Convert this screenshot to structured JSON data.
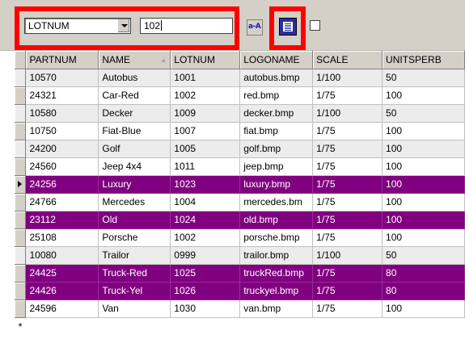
{
  "toolbar": {
    "field_select": "LOTNUM",
    "search_text": "102",
    "sort_button_label": "a-A",
    "checkbox_checked": false
  },
  "grid": {
    "columns": [
      "PARTNUM",
      "NAME",
      "LOTNUM",
      "LOGONAME",
      "SCALE",
      "UNITSPERB"
    ],
    "sorted_column": "NAME",
    "current_row": 6,
    "rows": [
      {
        "cells": [
          "10570",
          "Autobus",
          "1001",
          "autobus.bmp",
          "1/100",
          "50"
        ],
        "highlighted": false
      },
      {
        "cells": [
          "24321",
          "Car-Red",
          "1002",
          "red.bmp",
          "1/75",
          "100"
        ],
        "highlighted": false
      },
      {
        "cells": [
          "10580",
          "Decker",
          "1009",
          "decker.bmp",
          "1/100",
          "50"
        ],
        "highlighted": false
      },
      {
        "cells": [
          "10750",
          "Fiat-Blue",
          "1007",
          "fiat.bmp",
          "1/75",
          "100"
        ],
        "highlighted": false
      },
      {
        "cells": [
          "24200",
          "Golf",
          "1005",
          "golf.bmp",
          "1/75",
          "100"
        ],
        "highlighted": false
      },
      {
        "cells": [
          "24560",
          "Jeep 4x4",
          "1011",
          "jeep.bmp",
          "1/75",
          "100"
        ],
        "highlighted": false
      },
      {
        "cells": [
          "24256",
          "Luxury",
          "1023",
          "luxury.bmp",
          "1/75",
          "100"
        ],
        "highlighted": true
      },
      {
        "cells": [
          "24766",
          "Mercedes",
          "1004",
          "mercedes.bm",
          "1/75",
          "100"
        ],
        "highlighted": false
      },
      {
        "cells": [
          "23112",
          "Old",
          "1024",
          "old.bmp",
          "1/75",
          "100"
        ],
        "highlighted": true
      },
      {
        "cells": [
          "25108",
          "Porsche",
          "1002",
          "porsche.bmp",
          "1/75",
          "100"
        ],
        "highlighted": false
      },
      {
        "cells": [
          "10080",
          "Trailor",
          "0999",
          "trailor.bmp",
          "1/100",
          "50"
        ],
        "highlighted": false
      },
      {
        "cells": [
          "24425",
          "Truck-Red",
          "1025",
          "truckRed.bmp",
          "1/75",
          "80"
        ],
        "highlighted": true
      },
      {
        "cells": [
          "24426",
          "Truck-Yel",
          "1026",
          "truckyel.bmp",
          "1/75",
          "80"
        ],
        "highlighted": true
      },
      {
        "cells": [
          "24596",
          "Van",
          "1030",
          "van.bmp",
          "1/75",
          "100"
        ],
        "highlighted": false
      }
    ],
    "new_row_marker": "*"
  },
  "colors": {
    "highlight_row": "#800080",
    "annotation_box": "#ff0000",
    "alternate_row": "#ececec"
  }
}
